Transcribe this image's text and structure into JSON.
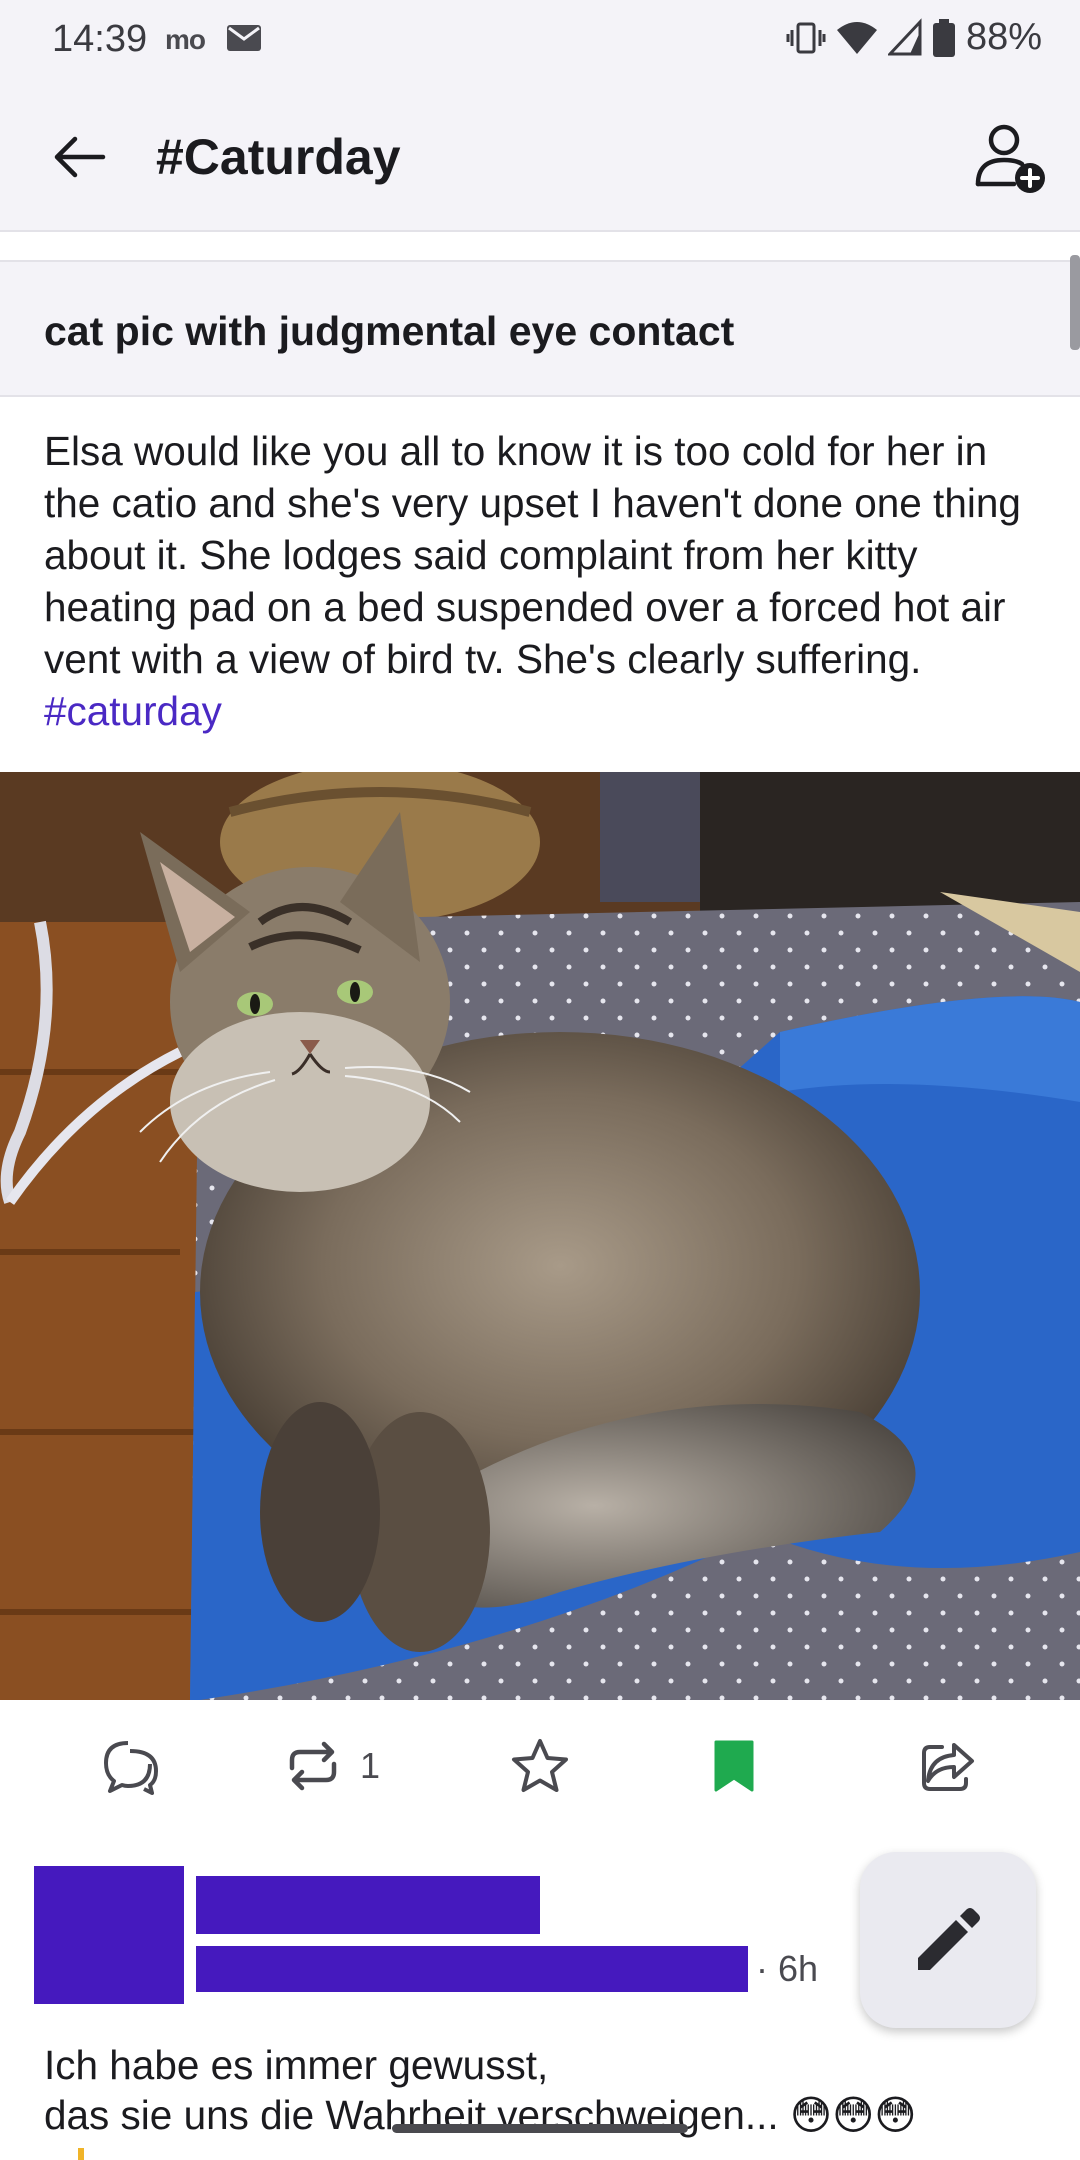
{
  "status_bar": {
    "time": "14:39",
    "carrier_badge": "mo",
    "battery_percent": "88%"
  },
  "header": {
    "title": "#Caturday"
  },
  "post": {
    "content_warning": "cat pic with judgmental eye contact",
    "body_text": "Elsa would like you all to know it is too cold for her in the catio and she's very upset I haven't done one thing about it. She lodges said complaint from her kitty heating pad on a bed suspended over a forced hot air vent with a view of bird tv. She's clearly suffering. ",
    "hashtag": "#caturday",
    "actions": {
      "boost_count": "1"
    }
  },
  "reply": {
    "time": "· 6h",
    "text_line1": "Ich habe es immer gewusst,",
    "text_line2": "das sie uns die Wahrheit verschweigen... 😳😳😳"
  },
  "colors": {
    "accent": "#4a29c4",
    "redaction": "#4519be",
    "bookmark_active": "#1faa4f",
    "bar_background": "#f4f3f8"
  },
  "icons": [
    "back-arrow-icon",
    "follow-user-icon",
    "reply-icon",
    "boost-icon",
    "favourite-star-icon",
    "bookmark-icon",
    "share-icon",
    "pencil-icon"
  ]
}
